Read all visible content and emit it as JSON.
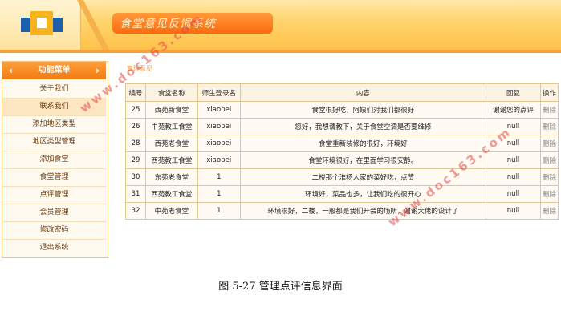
{
  "header": {
    "title": "食堂意见反馈系统"
  },
  "sidebar": {
    "menu_title": "功能菜单",
    "items": [
      "关于我们",
      "联系我们",
      "添加地区类型",
      "地区类型管理",
      "添加食堂",
      "食堂管理",
      "点评管理",
      "会员管理",
      "修改密码",
      "退出系统"
    ]
  },
  "breadcrumb": "管理意见",
  "table": {
    "headers": [
      "编号",
      "食堂名称",
      "师生登录名",
      "内容",
      "回复",
      "操作"
    ],
    "rows": [
      {
        "id": "25",
        "canteen": "西苑新食堂",
        "login": "xiaopei",
        "content": "食堂很好吃，阿姨们对我们都很好",
        "reply": "谢谢您的点评",
        "op": "删除"
      },
      {
        "id": "26",
        "canteen": "中苑教工食堂",
        "login": "xiaopei",
        "content": "您好，我想请教下，关于食堂空调是否要维修",
        "reply": "null",
        "op": "删除"
      },
      {
        "id": "28",
        "canteen": "西苑老食堂",
        "login": "xiaopei",
        "content": "食堂重新装修的很好，环境好",
        "reply": "null",
        "op": "删除"
      },
      {
        "id": "29",
        "canteen": "西苑教工食堂",
        "login": "xiaopei",
        "content": "食堂环境很好，在里面学习很安静。",
        "reply": "null",
        "op": "删除"
      },
      {
        "id": "30",
        "canteen": "东苑老食堂",
        "login": "1",
        "content": "二楼那个淮杨人家的菜好吃，点赞",
        "reply": "null",
        "op": "删除"
      },
      {
        "id": "31",
        "canteen": "西苑教工食堂",
        "login": "1",
        "content": "环境好，菜品也多，让我们吃的很开心",
        "reply": "null",
        "op": "删除"
      },
      {
        "id": "32",
        "canteen": "中苑老食堂",
        "login": "1",
        "content": "环境很好，二楼，一般都是我们开会的场所，谢谢大佬的设计了",
        "reply": "null",
        "op": "删除"
      }
    ]
  },
  "caption": "图 5-27 管理点评信息界面",
  "watermark": "www.doc163.com",
  "colors": {
    "accent": "#f47a12",
    "header_bg": "#ffc24a",
    "border": "#e6c594",
    "logo_blue": "#1f5ea8"
  }
}
